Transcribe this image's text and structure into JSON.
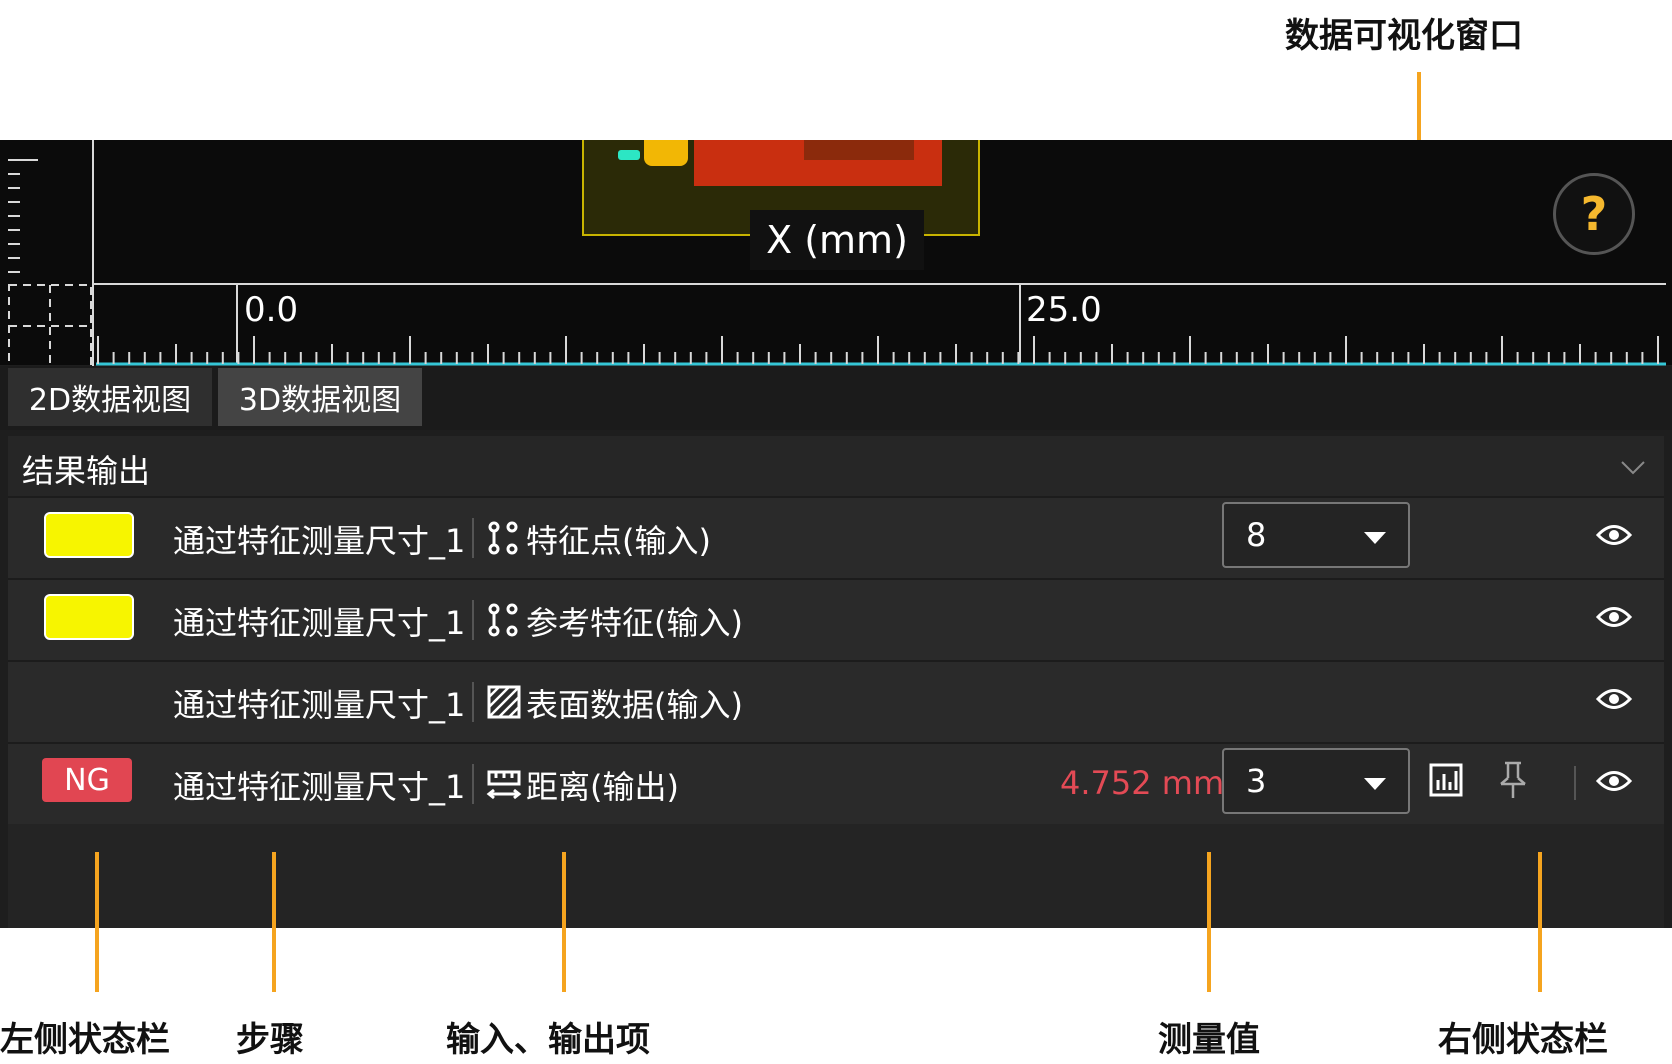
{
  "callouts": {
    "viz_window": "数据可视化窗口",
    "left_status": "左侧状态栏",
    "step": "步骤",
    "io_items": "输入、输出项",
    "measure_value": "测量值",
    "right_status": "右侧状态栏"
  },
  "viewer": {
    "axis_title": "X (mm)",
    "tick_labels": [
      "0.0",
      "25.0"
    ],
    "help_label": "?"
  },
  "tabs": [
    {
      "label": "2D数据视图",
      "active": false
    },
    {
      "label": "3D数据视图",
      "active": true
    }
  ],
  "panel": {
    "title": "结果输出",
    "rows": [
      {
        "status": "swatch",
        "swatch_color": "#f7f500",
        "step": "通过特征测量尺寸_1",
        "io_icon": "feature-points-icon",
        "io_label": "特征点(输入)",
        "select_value": "8"
      },
      {
        "status": "swatch",
        "swatch_color": "#f7f500",
        "step": "通过特征测量尺寸_1",
        "io_icon": "feature-points-icon",
        "io_label": "参考特征(输入)"
      },
      {
        "status": "none",
        "step": "通过特征测量尺寸_1",
        "io_icon": "surface-data-icon",
        "io_label": "表面数据(输入)"
      },
      {
        "status": "NG",
        "step": "通过特征测量尺寸_1",
        "io_icon": "distance-icon",
        "io_label": "距离(输出)",
        "measure": "4.752 mm",
        "select_value": "3"
      }
    ]
  },
  "colors": {
    "accent_orange": "#f5a41f",
    "ng_red": "#e14652",
    "swatch_yellow": "#f7f500"
  }
}
